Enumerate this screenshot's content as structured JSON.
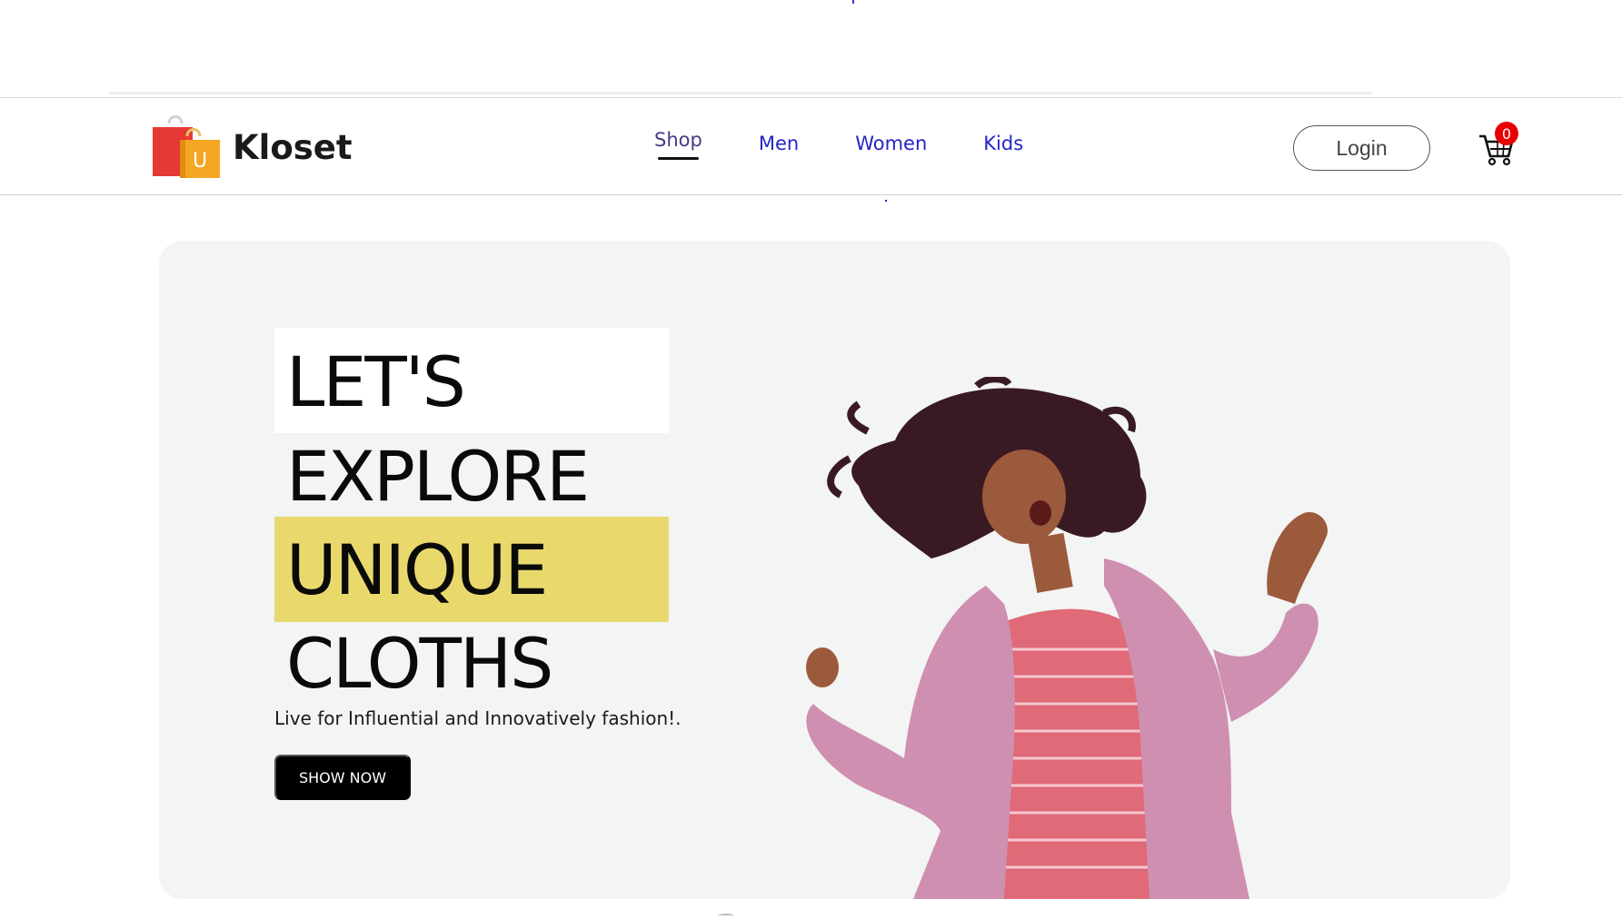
{
  "brand": {
    "name": "Kloset",
    "logo_letter": "U",
    "colors": {
      "bag_red": "#e53935",
      "bag_orange": "#f5a623"
    }
  },
  "nav": {
    "links": [
      {
        "label": "Shop",
        "active": true
      },
      {
        "label": "Men",
        "active": false
      },
      {
        "label": "Women",
        "active": false
      },
      {
        "label": "Kids",
        "active": false
      }
    ],
    "link_color": "#2424c8"
  },
  "header": {
    "login_label": "Login",
    "cart_icon": "shopping-cart-icon",
    "cart_count": "0",
    "badge_color": "#e80000"
  },
  "hero": {
    "headline": [
      "LET'S",
      "EXPLORE",
      "UNIQUE",
      "CLOTHS"
    ],
    "tagline": "Live for Influential and Innovatively fashion!.",
    "cta_label": "SHOW NOW",
    "highlight_color": "#e9d96d",
    "image": "woman-in-pink-fur-coat-dancing"
  }
}
